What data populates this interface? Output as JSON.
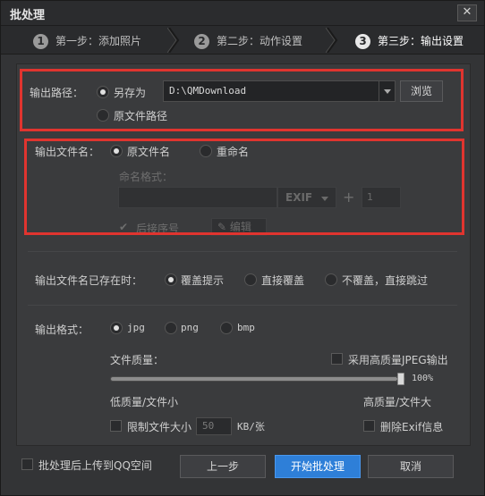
{
  "window": {
    "title": "批处理",
    "close": "✕"
  },
  "steps": [
    {
      "num": "1",
      "label": "第一步：添加照片"
    },
    {
      "num": "2",
      "label": "第二步：动作设置"
    },
    {
      "num": "3",
      "label": "第三步：输出设置"
    }
  ],
  "output_path": {
    "label": "输出路径：",
    "save_as": "另存为",
    "original_path": "原文件路径",
    "path_value": "D:\\QMDownload",
    "browse": "浏览"
  },
  "output_filename": {
    "label": "输出文件名：",
    "original_name": "原文件名",
    "rename": "重命名",
    "naming_format": "命名格式：",
    "exif": "EXIF",
    "plus": "+",
    "seq_value": "1",
    "suffix_seq": "后接序号",
    "edit": "编辑"
  },
  "exists": {
    "label": "输出文件名已存在时：",
    "prompt": "覆盖提示",
    "overwrite": "直接覆盖",
    "skip": "不覆盖，直接跳过"
  },
  "format": {
    "label": "输出格式：",
    "jpg": "jpg",
    "png": "png",
    "bmp": "bmp",
    "quality_label": "文件质量：",
    "high_jpeg": "采用高质量JPEG输出",
    "quality_percent": "100%",
    "quality_value": 1.0,
    "low_label": "低质量/文件小",
    "high_label": "高质量/文件大",
    "limit_size": "限制文件大小",
    "size_value": "50",
    "size_unit": "KB/张",
    "delete_exif": "删除Exif信息"
  },
  "footer": {
    "upload_qq": "批处理后上传到QQ空间",
    "prev": "上一步",
    "start": "开始批处理",
    "cancel": "取消"
  }
}
